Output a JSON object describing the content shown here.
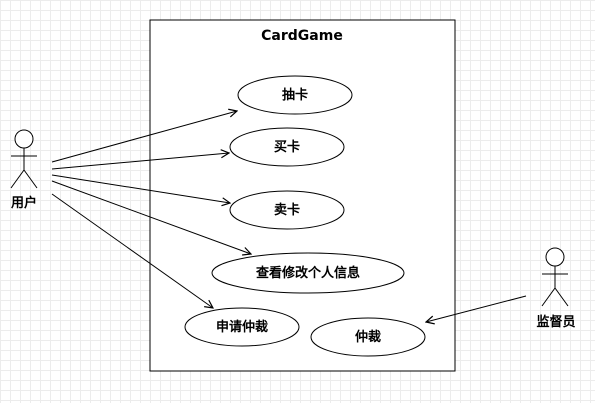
{
  "system": {
    "name": "CardGame"
  },
  "actors": {
    "user": {
      "name": "用户"
    },
    "supervisor": {
      "name": "监督员"
    }
  },
  "use_cases": {
    "draw_card": "抽卡",
    "buy_card": "买卡",
    "sell_card": "卖卡",
    "edit_profile": "查看修改个人信息",
    "request_arbitration": "申请仲裁",
    "arbitration": "仲裁"
  }
}
